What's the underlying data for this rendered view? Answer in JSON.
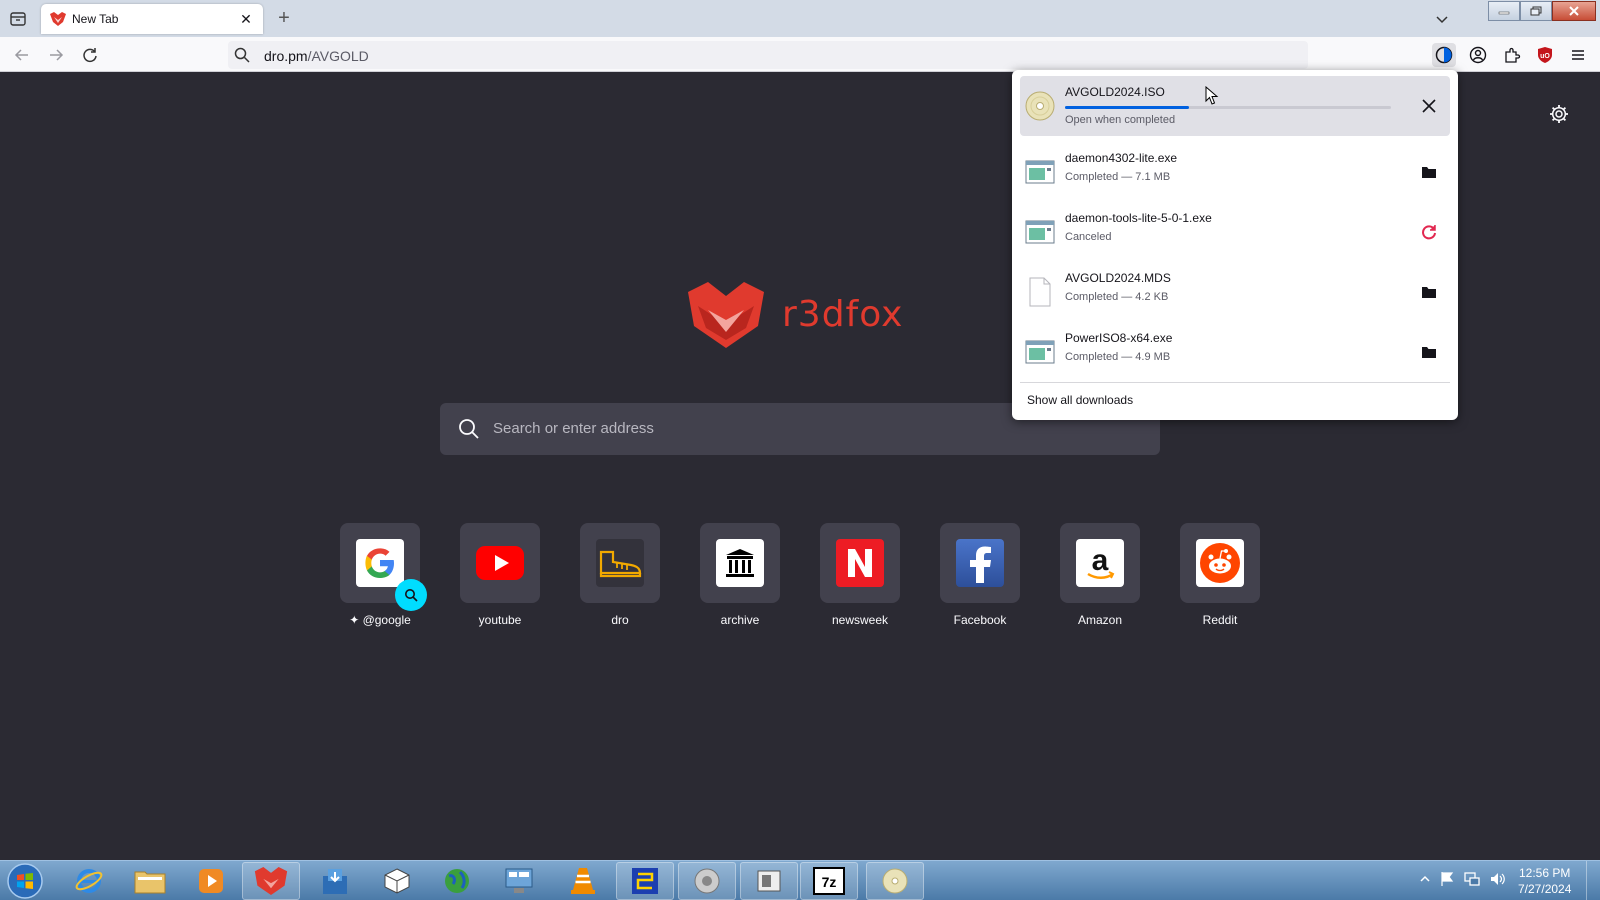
{
  "browser": {
    "tab": {
      "title": "New Tab",
      "close": "✕"
    },
    "new_tab": "+",
    "url": {
      "host": "dro.pm",
      "path": "/AVGOLD"
    }
  },
  "newtab": {
    "brand": "r3dfox",
    "search_placeholder": "Search or enter address",
    "shortcuts": [
      {
        "label": "@google",
        "icon": "google-icon"
      },
      {
        "label": "youtube",
        "icon": "youtube-icon"
      },
      {
        "label": "dro",
        "icon": "boot-icon"
      },
      {
        "label": "archive",
        "icon": "archive-icon"
      },
      {
        "label": "newsweek",
        "icon": "newsweek-icon"
      },
      {
        "label": "Facebook",
        "icon": "facebook-icon"
      },
      {
        "label": "Amazon",
        "icon": "amazon-icon"
      },
      {
        "label": "Reddit",
        "icon": "reddit-icon"
      }
    ]
  },
  "downloads": {
    "items": [
      {
        "name": "AVGOLD2024.ISO",
        "status": "Open when completed",
        "progress": 0.38,
        "state": "in-progress"
      },
      {
        "name": "daemon4302-lite.exe",
        "status": "Completed — 7.1 MB",
        "state": "completed"
      },
      {
        "name": "daemon-tools-lite-5-0-1.exe",
        "status": "Canceled",
        "state": "canceled"
      },
      {
        "name": "AVGOLD2024.MDS",
        "status": "Completed — 4.2 KB",
        "state": "completed"
      },
      {
        "name": "PowerISO8-x64.exe",
        "status": "Completed — 4.9 MB",
        "state": "completed"
      }
    ],
    "show_all": "Show all downloads"
  },
  "taskbar": {
    "clock_time": "12:56 PM",
    "clock_date": "7/27/2024"
  },
  "colors": {
    "page_bg": "#2b2a33",
    "tile_bg": "#42414d",
    "brand_red": "#e03a2e",
    "progress": "#0061e0"
  }
}
